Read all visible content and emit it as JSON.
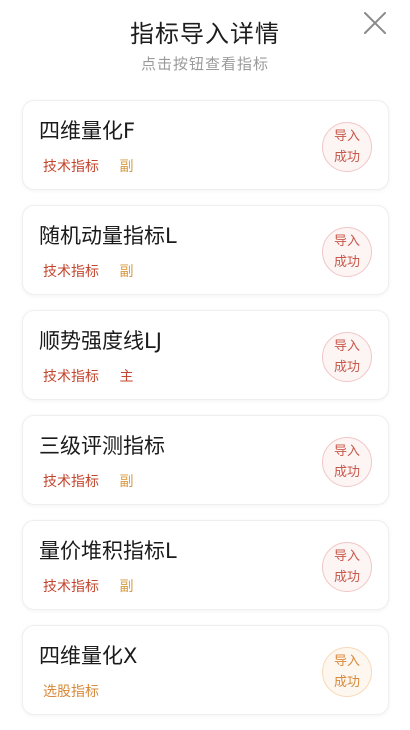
{
  "header": {
    "title": "指标导入详情",
    "subtitle": "点击按钮查看指标"
  },
  "items": [
    {
      "name": "四维量化F",
      "tag": "技术指标",
      "role": "副",
      "status_line1": "导入",
      "status_line2": "成功"
    },
    {
      "name": "随机动量指标L",
      "tag": "技术指标",
      "role": "副",
      "status_line1": "导入",
      "status_line2": "成功"
    },
    {
      "name": "顺势强度线LJ",
      "tag": "技术指标",
      "role": "主",
      "status_line1": "导入",
      "status_line2": "成功"
    },
    {
      "name": "三级评测指标",
      "tag": "技术指标",
      "role": "副",
      "status_line1": "导入",
      "status_line2": "成功"
    },
    {
      "name": "量价堆积指标L",
      "tag": "技术指标",
      "role": "副",
      "status_line1": "导入",
      "status_line2": "成功"
    },
    {
      "name": "四维量化X",
      "tag": "选股指标",
      "role": "",
      "status_line1": "导入",
      "status_line2": "成功"
    }
  ],
  "colors": {
    "tag_red": "#c3472f",
    "role_orange": "#d79a3f",
    "status_red": "#c6584a",
    "status_orange": "#d8893a"
  },
  "icons": {
    "close": "close-icon"
  }
}
